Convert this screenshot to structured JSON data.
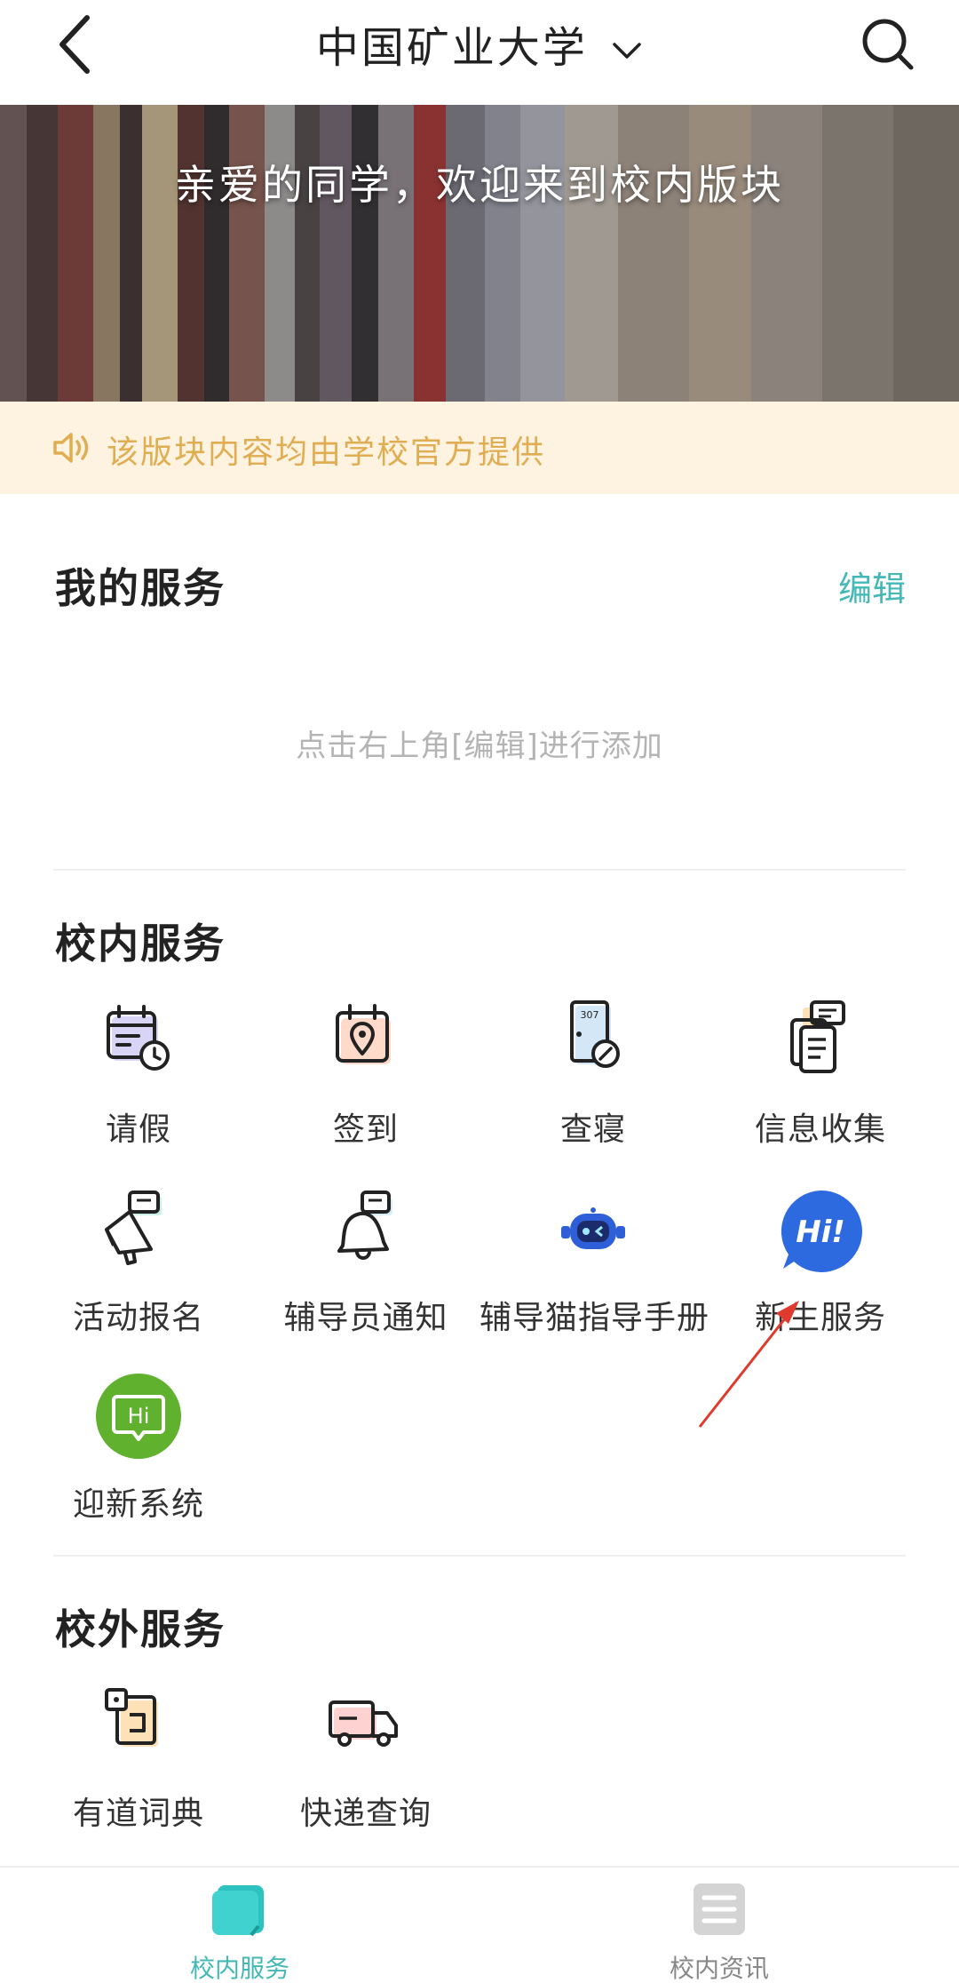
{
  "header": {
    "title": "中国矿业大学",
    "back_icon": "chevron-left-icon",
    "dropdown_icon": "chevron-down-icon",
    "search_icon": "search-icon"
  },
  "banner": {
    "text": "亲爱的同学，欢迎来到校内版块"
  },
  "notice": {
    "icon": "speaker-icon",
    "text": "该版块内容均由学校官方提供",
    "color": "#e0ad52",
    "background": "#fdf3e0"
  },
  "my_services": {
    "title": "我的服务",
    "edit_label": "编辑",
    "empty_hint": "点击右上角[编辑]进行添加"
  },
  "campus_services": {
    "title": "校内服务",
    "items": [
      {
        "label": "请假",
        "icon": "calendar-clock-icon"
      },
      {
        "label": "签到",
        "icon": "calendar-location-icon"
      },
      {
        "label": "查寝",
        "icon": "door-edit-icon"
      },
      {
        "label": "信息收集",
        "icon": "document-chat-icon"
      },
      {
        "label": "活动报名",
        "icon": "megaphone-icon"
      },
      {
        "label": "辅导员通知",
        "icon": "bell-chat-icon"
      },
      {
        "label": "辅导猫指导手册",
        "icon": "robot-icon"
      },
      {
        "label": "新生服务",
        "icon": "hi-bubble-blue-icon"
      },
      {
        "label": "迎新系统",
        "icon": "hi-bubble-green-icon"
      }
    ],
    "door_number": "307",
    "hi_text": "Hi!",
    "hi_text_green": "Hi"
  },
  "external_services": {
    "title": "校外服务",
    "items": [
      {
        "label": "有道词典",
        "icon": "dictionary-icon"
      },
      {
        "label": "快递查询",
        "icon": "delivery-truck-icon"
      }
    ]
  },
  "tabbar": {
    "tabs": [
      {
        "label": "校内服务",
        "icon": "campus-services-tab-icon",
        "active": true
      },
      {
        "label": "校内资讯",
        "icon": "campus-news-tab-icon",
        "active": false
      }
    ],
    "active_color": "#43b8b6",
    "inactive_color": "#888888"
  },
  "annotation": {
    "arrow_color": "#e03a2f"
  }
}
